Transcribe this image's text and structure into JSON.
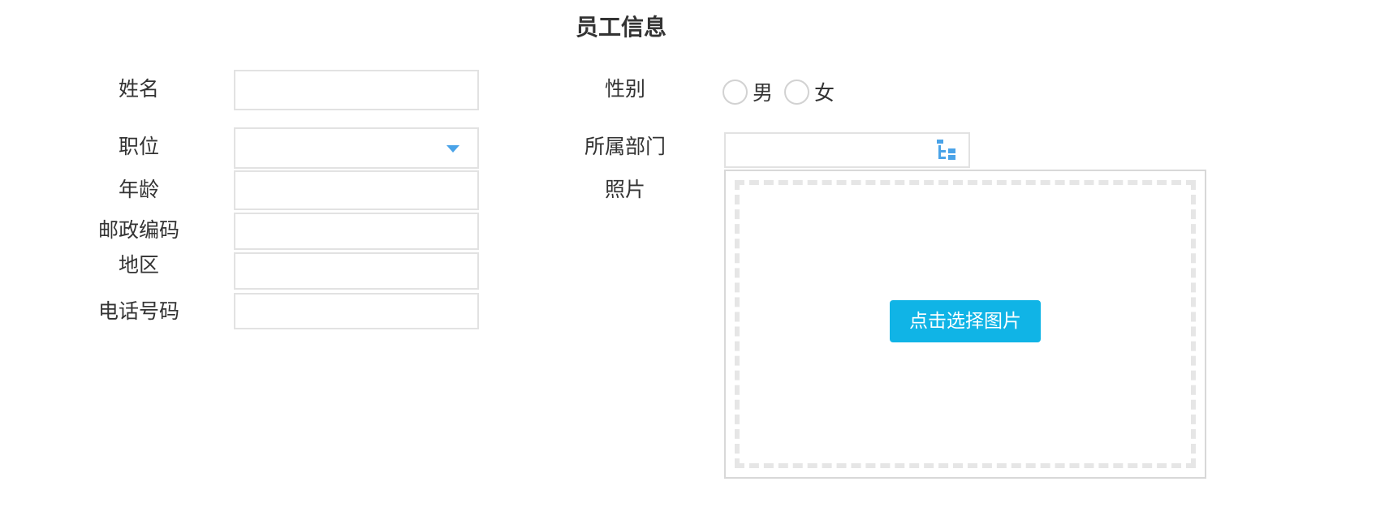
{
  "form": {
    "title": "员工信息",
    "name": {
      "label": "姓名",
      "value": ""
    },
    "gender": {
      "label": "性别",
      "options": [
        "男",
        "女"
      ],
      "selected": ""
    },
    "position": {
      "label": "职位",
      "value": ""
    },
    "department": {
      "label": "所属部门",
      "value": ""
    },
    "age": {
      "label": "年龄",
      "value": ""
    },
    "photo": {
      "label": "照片",
      "button_label": "点击选择图片"
    },
    "postal_code": {
      "label": "邮政编码",
      "value": ""
    },
    "region": {
      "label": "地区",
      "value": ""
    },
    "phone": {
      "label": "电话号码",
      "value": ""
    }
  },
  "icons": {
    "select_caret": "chevron-down-icon",
    "department_picker": "tree-icon"
  },
  "colors": {
    "accent_button": "#10b4e6",
    "caret": "#4aa3e8",
    "tree_icon": "#4aa3e8",
    "border": "#e2e2e2",
    "text": "#333333"
  }
}
